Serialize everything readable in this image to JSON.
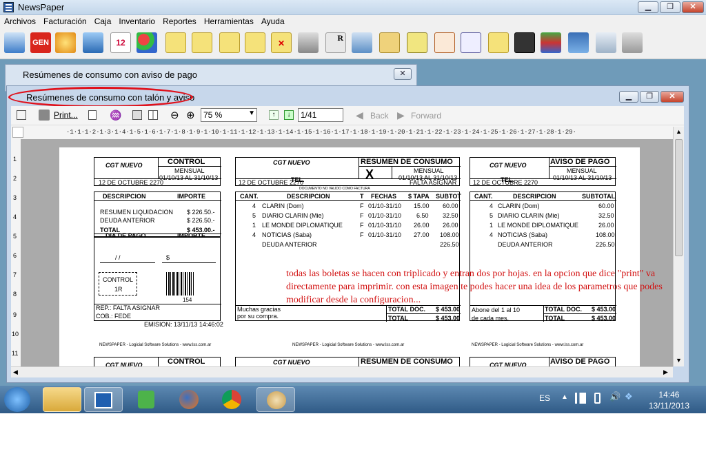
{
  "app": {
    "title": "NewsPaper"
  },
  "menu": [
    "Archivos",
    "Facturación",
    "Caja",
    "Inventario",
    "Reportes",
    "Herramientas",
    "Ayuda"
  ],
  "windows": {
    "w1_title": "Resúmenes de consumo con aviso de pago",
    "w2_title": "Resúmenes de consumo con talón y aviso"
  },
  "viewer": {
    "print_label": "Print...",
    "zoom": "75 %",
    "page": "1/41",
    "back": "Back",
    "forward": "Forward"
  },
  "ruler": "·1·1·1·2·1·3·1·4·1·5·1·6·1·7·1·8·1·9·1·10·1·11·1·12·1·13·1·14·1·15·1·16·1·17·1·18·1·19·1·20·1·21·1·22·1·23·1·24·1·25·1·26·1·27·1·28·1·29·",
  "ruler_left": [
    "1",
    "2",
    "3",
    "4",
    "5",
    "6",
    "7",
    "8",
    "9",
    "10",
    "11"
  ],
  "report": {
    "control": {
      "company": "CGT NUEVO",
      "title": "CONTROL",
      "period_label": "MENSUAL",
      "period": "01/10/13 AL 31/10/13",
      "address": "12 DE OCTUBRE 2270",
      "desc_h": "DESCRIPCION",
      "imp_h": "IMPORTE",
      "items": [
        [
          "RESUMEN LIQUIDACION",
          "$ 226.50.-"
        ],
        [
          "DEUDA ANTERIOR",
          "$ 226.50.-"
        ]
      ],
      "total_label": "TOTAL",
      "total": "$ 453.00.-",
      "pay_h": "DIA DE PAGO",
      "pay_imp_h": "IMPORTE",
      "date_slashes": "/      /",
      "dollar": "$",
      "control_box": "CONTROL",
      "control_box2": "1R",
      "barcode_num": "154",
      "rep": "REP.: FALTA ASIGNAR",
      "cob": "COB.: FEDE",
      "emision": "EMISION: 13/11/13 14:46:02",
      "footer": "NEWSPAPER - Logicial Software Solutions - www.lss.com.ar"
    },
    "resumen": {
      "company": "CGT NUEVO",
      "title": "RESUMEN DE CONSUMO",
      "mark": "X",
      "tel": "TEL.",
      "period_label": "MENSUAL",
      "period": "01/10/13 AL 31/10/13",
      "address": "12 DE OCTUBRE 2270",
      "status": "FALTA ASIGNAR",
      "notvalid": "DOCUMENTO NO VALIDO COMO FACTURA",
      "headers": [
        "CANT.",
        "DESCRIPCION",
        "T",
        "FECHAS",
        "$ TAPA",
        "SUBTOT"
      ],
      "rows": [
        [
          "4",
          "CLARIN (Dom)",
          "F",
          "01/10-31/10",
          "15.00",
          "60.00"
        ],
        [
          "5",
          "DIARIO CLARIN (Mie)",
          "F",
          "01/10-31/10",
          "6.50",
          "32.50"
        ],
        [
          "1",
          "LE MONDE DIPLOMATIQUE",
          "F",
          "01/10-31/10",
          "26.00",
          "26.00"
        ],
        [
          "4",
          "NOTICIAS (Saba)",
          "F",
          "01/10-31/10",
          "27.00",
          "108.00"
        ]
      ],
      "prev_label": "DEUDA ANTERIOR",
      "prev": "226.50",
      "thanks1": "Muchas gracias",
      "thanks2": "por su compra.",
      "total_doc_label": "TOTAL DOC.",
      "total_doc": "$ 453.00",
      "total_label": "TOTAL",
      "total": "$ 453.00",
      "footer": "NEWSPAPER - Logicial Software Solutions - www.lss.com.ar"
    },
    "aviso": {
      "company": "CGT NUEVO",
      "title": "AVISO DE PAGO",
      "tel": "TEL.",
      "period_label": "MENSUAL",
      "period": "01/10/13 AL 31/10/13",
      "address": "12 DE OCTUBRE 2270",
      "headers": [
        "CANT.",
        "DESCRIPCION",
        "SUBTOTAL"
      ],
      "rows": [
        [
          "4",
          "CLARIN (Dom)",
          "60.00"
        ],
        [
          "5",
          "DIARIO CLARIN (Mie)",
          "32.50"
        ],
        [
          "1",
          "LE MONDE DIPLOMATIQUE",
          "26.00"
        ],
        [
          "4",
          "NOTICIAS (Saba)",
          "108.00"
        ]
      ],
      "prev_label": "DEUDA ANTERIOR",
      "prev": "226.50",
      "abone1": "Abone del 1 al 10",
      "abone2": "de cada mes.",
      "total_doc_label": "TOTAL DOC.",
      "total_doc": "$ 453.00",
      "total_label": "TOTAL",
      "total": "$ 453.00",
      "footer": "NEWSPAPER - Logicial Software Solutions - www.lss.com.ar"
    },
    "next_row": {
      "control": "CONTROL",
      "company": "CGT NUEVO",
      "resumen": "RESUMEN DE CONSUMO",
      "aviso": "AVISO DE PAGO"
    }
  },
  "annotation": "todas las boletas se hacen con triplicado y entran dos por hojas. en la opcion que dice \"print\" va directamente para imprimir. con esta imagen te podes hacer una idea de los parametros que podes modificar desde la configuracion...",
  "taskbar": {
    "lang": "ES",
    "time": "14:46",
    "date": "13/11/2013"
  },
  "colors": {
    "accent_red": "#d21010",
    "taskbar": "#3a6590",
    "desktop": "#6f9bb9"
  }
}
